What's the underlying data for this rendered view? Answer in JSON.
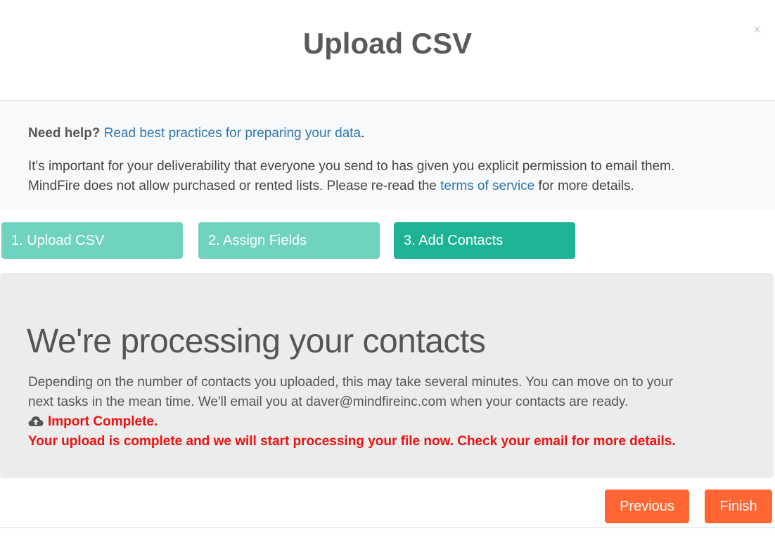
{
  "modal": {
    "title": "Upload CSV",
    "close_symbol": "×"
  },
  "help": {
    "label": "Need help?",
    "link_text": "Read best practices for preparing your data",
    "link_suffix": ".",
    "body_line1": "It's important for your deliverability that everyone you send to has given you explicit permission to email them.",
    "body_line2_prefix": "MindFire does not allow purchased or rented lists. Please re-read the ",
    "tos_link": "terms of service",
    "body_line2_suffix": " for more details."
  },
  "steps": [
    {
      "label": "1. Upload CSV",
      "active": false
    },
    {
      "label": "2. Assign Fields",
      "active": false
    },
    {
      "label": "3. Add Contacts",
      "active": true
    }
  ],
  "processing": {
    "title": "We're processing your contacts",
    "line1": "Depending on the number of contacts you uploaded, this may take several minutes. You can move on to your",
    "line2": "next tasks in the mean time. We'll email you at daver@mindfireinc.com when your contacts are ready.",
    "status_icon": "cloud-upload-icon",
    "status_title": "Import Complete.",
    "status_detail": "Your upload is complete and we will start processing your file now. Check your email for more details."
  },
  "footer": {
    "previous_label": "Previous",
    "finish_label": "Finish"
  },
  "colors": {
    "step_inactive": "#6fd3bf",
    "step_active": "#1eb394",
    "button": "#ff6633",
    "status_text": "#ee1111",
    "link": "#2f77b0"
  }
}
